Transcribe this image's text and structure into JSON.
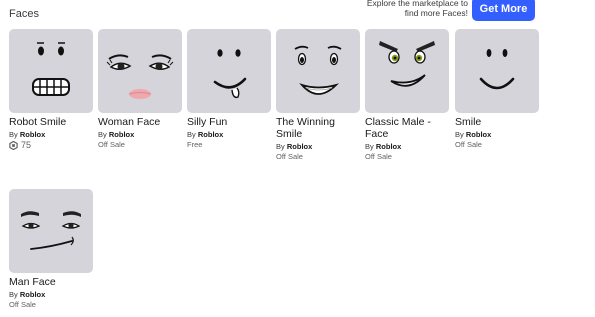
{
  "header": {
    "title": "Faces"
  },
  "promo": {
    "text_line1": "Explore the marketplace to",
    "text_line2": "find more Faces!",
    "button_label": "Get More"
  },
  "by_prefix": "By",
  "items": [
    {
      "name": "Robot Smile",
      "creator": "Roblox",
      "price": "75",
      "icon": "robux-icon"
    },
    {
      "name": "Woman Face",
      "creator": "Roblox",
      "price": "Off Sale"
    },
    {
      "name": "Silly Fun",
      "creator": "Roblox",
      "price": "Free"
    },
    {
      "name_line1": "The Winning",
      "name_line2": "Smile",
      "creator": "Roblox",
      "price": "Off Sale"
    },
    {
      "name_line1": "Classic Male -",
      "name_line2": "Face",
      "creator": "Roblox",
      "price": "Off Sale"
    },
    {
      "name": "Smile",
      "creator": "Roblox",
      "price": "Off Sale"
    },
    {
      "name": "Man Face",
      "creator": "Roblox",
      "price": "Off Sale"
    }
  ],
  "colors": {
    "accent": "#335fff",
    "thumb_bg": "#d4d4da"
  }
}
